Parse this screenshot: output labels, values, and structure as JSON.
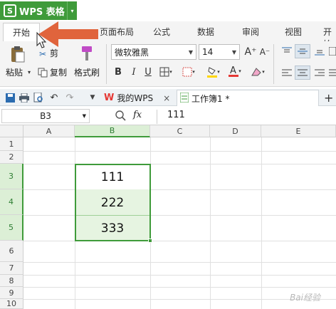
{
  "app": {
    "logo": "S",
    "title": "WPS 表格",
    "dropdown": "▾"
  },
  "menu_tabs": [
    {
      "label": "开始"
    },
    {
      "label": "页面布局"
    },
    {
      "label": "公式"
    },
    {
      "label": "数据"
    },
    {
      "label": "审阅"
    },
    {
      "label": "视图"
    },
    {
      "label": "开始"
    }
  ],
  "ribbon": {
    "paste_label": "粘贴",
    "cut_label": "剪",
    "copy_label": "复制",
    "format_painter_label": "格式刷",
    "font_name": "微软雅黑",
    "font_size": "14",
    "bold": "B",
    "italic": "I",
    "underline": "U",
    "increase_font": "A⁺",
    "decrease_font": "A⁻"
  },
  "doc_tabs": {
    "home_tab": "我的WPS",
    "workbook_tab": "工作簿1 *",
    "close": "×",
    "add": "+"
  },
  "formula_bar": {
    "name_box": "B3",
    "fx": "fx",
    "value": "111"
  },
  "sheet": {
    "columns": [
      "A",
      "B",
      "C",
      "D",
      "E"
    ],
    "rows": [
      "1",
      "2",
      "3",
      "4",
      "5",
      "6",
      "7",
      "8",
      "9",
      "10"
    ],
    "cells": {
      "B3": "111",
      "B4": "222",
      "B5": "333"
    }
  },
  "watermark": "Bai经验",
  "accent_color": "#3f9b3a",
  "arrow_color": "#e0643c"
}
